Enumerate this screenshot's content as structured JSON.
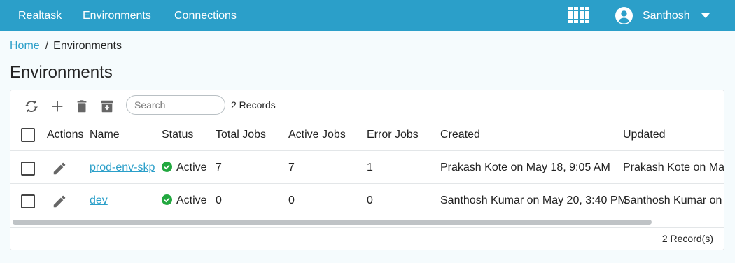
{
  "header": {
    "nav": [
      "Realtask",
      "Environments",
      "Connections"
    ],
    "apps_icon": "grid-apps-icon",
    "user": {
      "name": "Santhosh",
      "icon": "account-circle-icon"
    }
  },
  "breadcrumb": {
    "home": "Home",
    "separator": "/",
    "current": "Environments"
  },
  "page": {
    "title": "Environments"
  },
  "toolbar": {
    "icons": [
      "refresh-icon",
      "add-icon",
      "delete-icon",
      "archive-icon"
    ],
    "search_placeholder": "Search",
    "records": "2 Records"
  },
  "table": {
    "columns": [
      "Actions",
      "Name",
      "Status",
      "Total Jobs",
      "Active Jobs",
      "Error Jobs",
      "Created",
      "Updated"
    ],
    "rows": [
      {
        "name": "prod-env-skp",
        "status": "Active",
        "total_jobs": "7",
        "active_jobs": "7",
        "error_jobs": "1",
        "created": "Prakash Kote on May 18, 9:05 AM",
        "updated": "Prakash Kote on May"
      },
      {
        "name": "dev",
        "status": "Active",
        "total_jobs": "0",
        "active_jobs": "0",
        "error_jobs": "0",
        "created": "Santhosh Kumar on May 20, 3:40 PM",
        "updated": "Santhosh Kumar on M"
      }
    ],
    "scroll_fraction": 0.9
  },
  "footer": {
    "records": "2 Record(s)"
  },
  "colors": {
    "header_bg": "#2b9fc9",
    "link": "#2b9fc9",
    "active": "#22a83f",
    "background": "#f5fbfd"
  }
}
